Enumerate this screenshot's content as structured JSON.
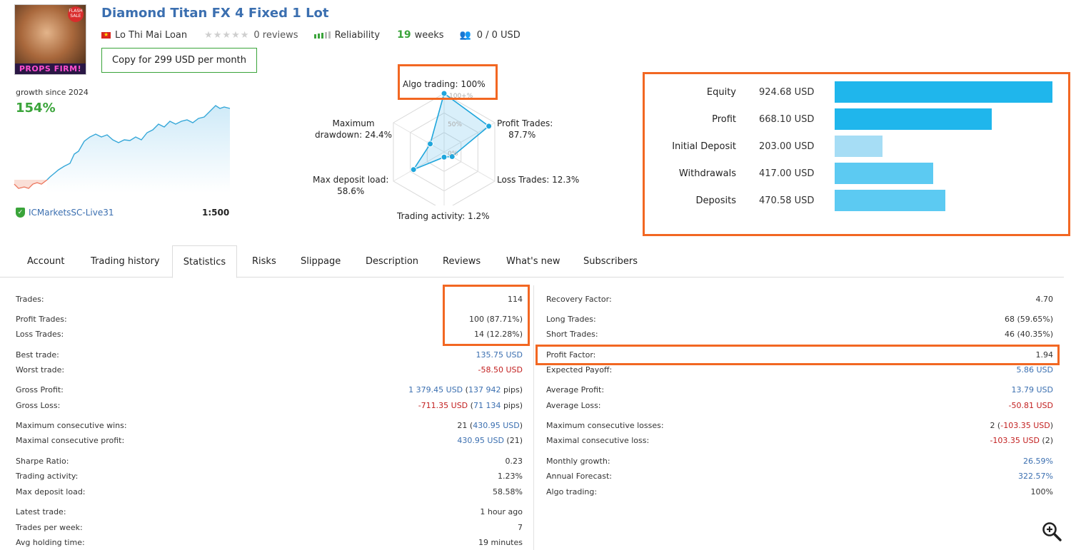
{
  "header": {
    "title": "Diamond Titan FX 4 Fixed 1 Lot",
    "author": "Lo Thi Mai Loan",
    "reviews": "0 reviews",
    "reliability_label": "Reliability",
    "weeks_num": "19",
    "weeks_label": "weeks",
    "subscribers_funds": "0 / 0 USD",
    "copy_button": "Copy for 299 USD per month",
    "avatar_sale": "FLASH SALE",
    "avatar_text": "PROPS FIRM!"
  },
  "growth": {
    "label": "growth since 2024",
    "value": "154%",
    "broker": "ICMarketsSC-Live31",
    "leverage": "1:500"
  },
  "radar": {
    "algo": "Algo trading: 100%",
    "profit_trades": "Profit Trades:",
    "profit_trades_val": "87.7%",
    "loss_trades": "Loss Trades: 12.3%",
    "trading_activity": "Trading activity: 1.2%",
    "max_deposit_load": "Max deposit load:",
    "max_deposit_load_val": "58.6%",
    "max_drawdown": "Maximum",
    "max_drawdown_val": "drawdown: 24.4%",
    "tick_100": "100+%",
    "tick_50": "50%",
    "tick_0": "0%",
    "values": [
      100,
      87.7,
      12.3,
      1.2,
      58.6,
      24.4
    ]
  },
  "balance": [
    {
      "label": "Equity",
      "value": "924.68 USD",
      "amount": 924.68,
      "color": "#1fb6ec"
    },
    {
      "label": "Profit",
      "value": "668.10 USD",
      "amount": 668.1,
      "color": "#1fb6ec"
    },
    {
      "label": "Initial Deposit",
      "value": "203.00 USD",
      "amount": 203.0,
      "color": "#a6ddf5"
    },
    {
      "label": "Withdrawals",
      "value": "417.00 USD",
      "amount": 417.0,
      "color": "#5ccaf2"
    },
    {
      "label": "Deposits",
      "value": "470.58 USD",
      "amount": 470.58,
      "color": "#5ccaf2"
    }
  ],
  "tabs": [
    "Account",
    "Trading history",
    "Statistics",
    "Risks",
    "Slippage",
    "Description",
    "Reviews",
    "What's new",
    "Subscribers"
  ],
  "active_tab": "Statistics",
  "stats_left": [
    {
      "k": "Trades:",
      "v": "114"
    },
    {
      "k": "Profit Trades:",
      "v": "100 (87.71%)"
    },
    {
      "k": "Loss Trades:",
      "v": "14 (12.28%)"
    },
    {
      "k": "Best trade:",
      "v": "135.75 USD"
    },
    {
      "k": "Worst trade:",
      "v": "-58.50 USD"
    },
    {
      "k": "Gross Profit:",
      "v": "1 379.45 USD",
      "v2": "137 942",
      "v3": " pips)"
    },
    {
      "k": "Gross Loss:",
      "v": "-711.35 USD",
      "v2": "71 134",
      "v3": " pips)"
    },
    {
      "k": "Maximum consecutive wins:",
      "v": "21 (",
      "v2": "430.95 USD",
      "v3": ")"
    },
    {
      "k": "Maximal consecutive profit:",
      "v": "430.95 USD",
      "v2": " (21)"
    },
    {
      "k": "Sharpe Ratio:",
      "v": "0.23"
    },
    {
      "k": "Trading activity:",
      "v": "1.23%"
    },
    {
      "k": "Max deposit load:",
      "v": "58.58%"
    },
    {
      "k": "Latest trade:",
      "v": "1 hour ago"
    },
    {
      "k": "Trades per week:",
      "v": "7"
    },
    {
      "k": "Avg holding time:",
      "v": "19 minutes"
    }
  ],
  "stats_right": [
    {
      "k": "Recovery Factor:",
      "v": "4.70"
    },
    {
      "k": "Long Trades:",
      "v": "68 (59.65%)"
    },
    {
      "k": "Short Trades:",
      "v": "46 (40.35%)"
    },
    {
      "k": "Profit Factor:",
      "v": "1.94"
    },
    {
      "k": "Expected Payoff:",
      "v": "5.86 USD"
    },
    {
      "k": "Average Profit:",
      "v": "13.79 USD"
    },
    {
      "k": "Average Loss:",
      "v": "-50.81 USD"
    },
    {
      "k": "Maximum consecutive losses:",
      "v": "2 (",
      "v2": "-103.35 USD",
      "v3": ")"
    },
    {
      "k": "Maximal consecutive loss:",
      "v": "-103.35 USD",
      "v2": " (2)"
    },
    {
      "k": "Monthly growth:",
      "v": "26.59%"
    },
    {
      "k": "Annual Forecast:",
      "v": "322.57%"
    },
    {
      "k": "Algo trading:",
      "v": "100%"
    }
  ]
}
